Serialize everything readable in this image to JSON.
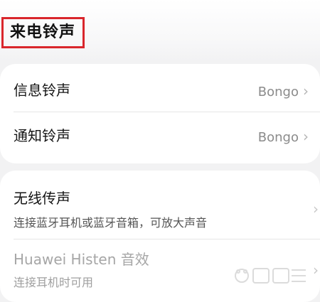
{
  "section": {
    "title": "来电铃声"
  },
  "ringtones": [
    {
      "label": "信息铃声",
      "value": "Bongo"
    },
    {
      "label": "通知铃声",
      "value": "Bongo"
    }
  ],
  "options": [
    {
      "label": "无线传声",
      "description": "连接蓝牙耳机或蓝牙音箱，可放大声音"
    },
    {
      "label": "Huawei Histen 音效",
      "description": "连接耳机时可用"
    }
  ],
  "icons": {
    "chevron": "chevron-right-icon"
  },
  "colors": {
    "highlight": "#d9262c"
  }
}
